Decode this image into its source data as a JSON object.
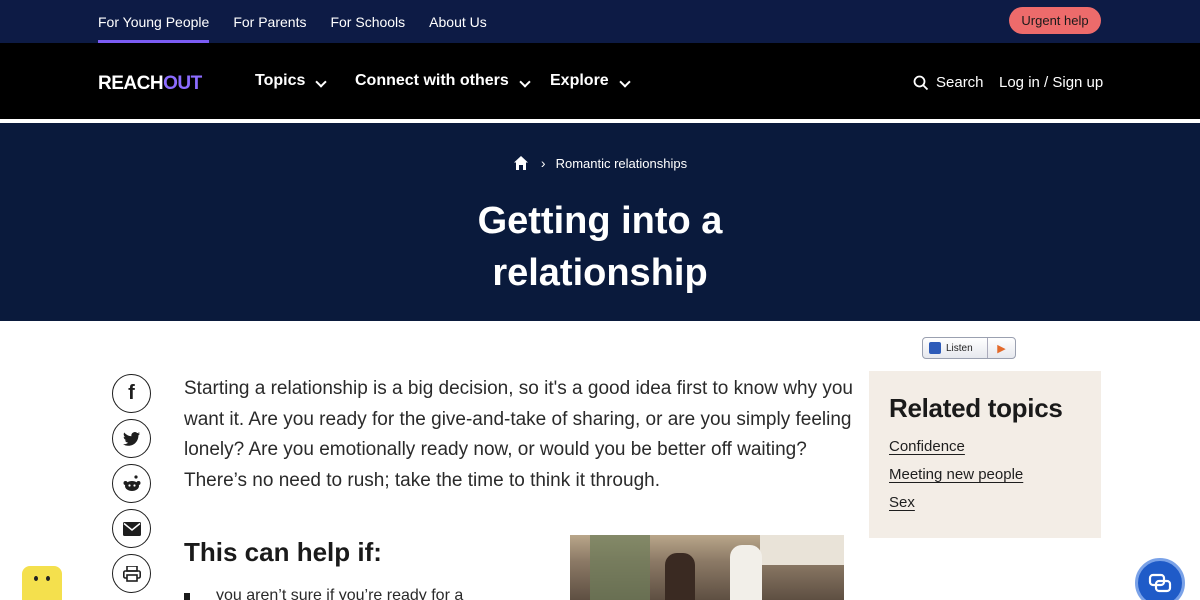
{
  "topbar": {
    "links": [
      "For Young People",
      "For Parents",
      "For Schools",
      "About Us"
    ],
    "urgent_label": "Urgent help"
  },
  "mainnav": {
    "logo_part1": "REACH",
    "logo_part2": "OUT",
    "items": [
      "Topics",
      "Connect with others",
      "Explore"
    ],
    "search_label": "Search",
    "login_label": "Log in / Sign up"
  },
  "hero": {
    "breadcrumb": "Romantic relationships",
    "title_line1": "Getting into a",
    "title_line2": "relationship"
  },
  "listen": {
    "label": "Listen"
  },
  "article": {
    "intro": "Starting a relationship is a big decision, so it's a good idea first to know why you want it. Are you ready for the give-and-take of sharing, or are you simply feeling lonely? Are you emotionally ready now, or would you be better off waiting? There’s no need to rush; take the time to think it through.",
    "help_heading": "This can help if:",
    "bullet1": "you aren’t sure if you’re ready for a"
  },
  "related": {
    "heading": "Related topics",
    "links": [
      "Confidence",
      "Meeting new people",
      "Sex"
    ]
  },
  "colors": {
    "topbar": "#0d1b45",
    "nav": "#000000",
    "hero": "#0a1a3c",
    "accent": "#7b5cf5",
    "urgent": "#ed6b6b",
    "related_bg": "#f3ede6"
  }
}
